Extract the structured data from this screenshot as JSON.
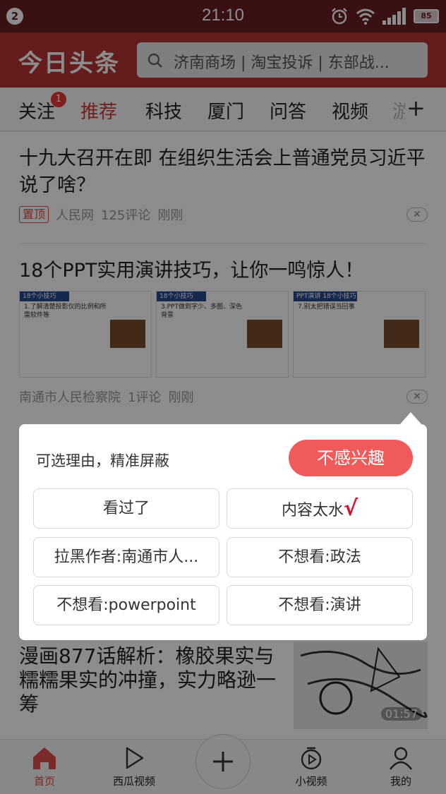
{
  "status_bar": {
    "notification_count": "2",
    "time": "21:10",
    "battery": "85",
    "icons": [
      "alarm-icon",
      "wifi-icon",
      "signal-icon",
      "battery-icon"
    ]
  },
  "header": {
    "logo": "今日头条",
    "search_hint": "济南商场 | 淘宝投诉 | 东部战..."
  },
  "tabs": {
    "items": [
      {
        "label": "关注",
        "badge": "1"
      },
      {
        "label": "推荐"
      },
      {
        "label": "科技"
      },
      {
        "label": "厦门"
      },
      {
        "label": "问答"
      },
      {
        "label": "视频"
      },
      {
        "label": "游"
      }
    ],
    "active": "推荐",
    "more": "+"
  },
  "feed": {
    "articles": [
      {
        "title": "十九大召开在即 在组织生活会上普通党员习近平说了啥？",
        "tag": "置顶",
        "source": "人民网",
        "comments": "125评论",
        "time": "刚刚"
      },
      {
        "title": "18个PPT实用演讲技巧，让你一鸣惊人！",
        "source": "南通市人民检察院",
        "comments": "1评论",
        "time": "刚刚",
        "thumbs": [
          {
            "badge": "18个小技巧",
            "text": "1.了解清楚投影仪的比例和所需软件等"
          },
          {
            "badge": "18个小技巧",
            "text": "3.PPT做到字少、多图、深色背景"
          },
          {
            "badge": "PPT演讲 18个小技巧",
            "text": "7.别太把错误当回事"
          }
        ]
      },
      {
        "title": "漫画877话解析：橡胶果实与糯糯果实的冲撞，实力略逊一筹",
        "duration": "01:57"
      }
    ]
  },
  "popup": {
    "hint": "可选理由，精准屏蔽",
    "button": "不感兴趣",
    "reasons": [
      {
        "label": "看过了"
      },
      {
        "label": "内容太水",
        "checked": "√"
      },
      {
        "label": "拉黑作者:南通市人..."
      },
      {
        "label": "不想看:政法"
      },
      {
        "label": "不想看:powerpoint"
      },
      {
        "label": "不想看:演讲"
      }
    ]
  },
  "bottom_nav": {
    "items": [
      {
        "label": "首页",
        "icon": "home-icon"
      },
      {
        "label": "西瓜视频",
        "icon": "play-icon"
      },
      {
        "label": "+",
        "icon": "plus-icon"
      },
      {
        "label": "小视频",
        "icon": "small-video-icon"
      },
      {
        "label": "我的",
        "icon": "profile-icon"
      }
    ]
  },
  "colors": {
    "brand_red": "#b63436",
    "status_bar": "#6a1f22",
    "accent": "#f05a5a"
  }
}
